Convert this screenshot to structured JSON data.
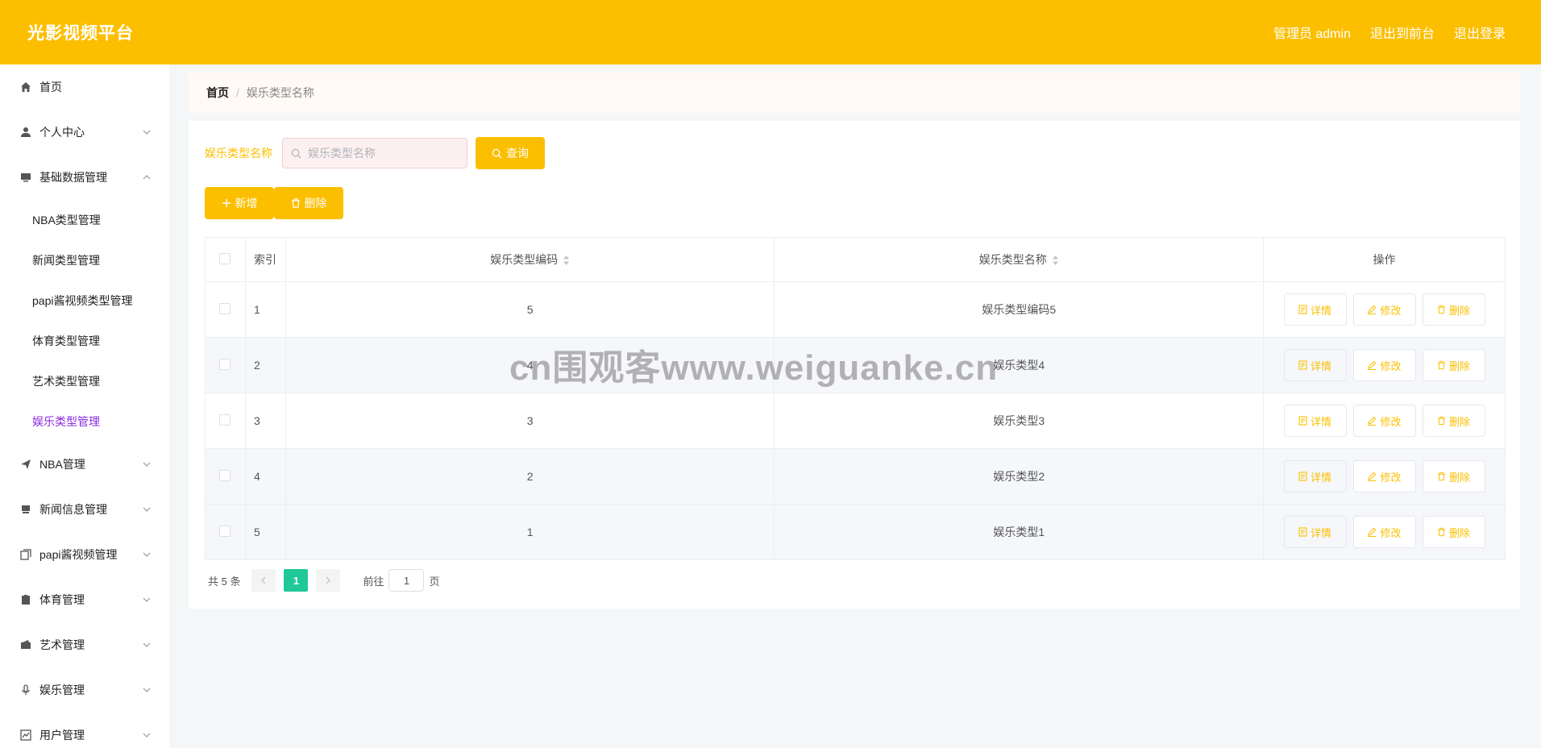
{
  "header": {
    "brand": "光影视频平台",
    "links": [
      "管理员 admin",
      "退出到前台",
      "退出登录"
    ]
  },
  "sidebar": {
    "items": [
      {
        "label": "首页",
        "icon": "home-icon"
      },
      {
        "label": "个人中心",
        "icon": "user-icon"
      },
      {
        "label": "基础数据管理",
        "icon": "monitor-icon"
      },
      {
        "label": "NBA管理",
        "icon": "send-icon"
      },
      {
        "label": "新闻信息管理",
        "icon": "printer-icon"
      },
      {
        "label": "papi酱视频管理",
        "icon": "copy-icon"
      },
      {
        "label": "体育管理",
        "icon": "clipboard-icon"
      },
      {
        "label": "艺术管理",
        "icon": "wallet-icon"
      },
      {
        "label": "娱乐管理",
        "icon": "microphone-icon"
      },
      {
        "label": "用户管理",
        "icon": "chart-icon"
      }
    ],
    "subitems": [
      "NBA类型管理",
      "新闻类型管理",
      "papi酱视频类型管理",
      "体育类型管理",
      "艺术类型管理",
      "娱乐类型管理"
    ]
  },
  "breadcrumb": {
    "home": "首页",
    "separator": "/",
    "current": "娱乐类型名称"
  },
  "search": {
    "label": "娱乐类型名称",
    "placeholder": "娱乐类型名称",
    "button": "查询"
  },
  "actions": {
    "add": "新增",
    "delete": "删除"
  },
  "table": {
    "headers": [
      "索引",
      "娱乐类型编码",
      "娱乐类型名称",
      "操作"
    ],
    "rows": [
      {
        "index": "1",
        "code": "5",
        "name": "娱乐类型编码5"
      },
      {
        "index": "2",
        "code": "4",
        "name": "娱乐类型4"
      },
      {
        "index": "3",
        "code": "3",
        "name": "娱乐类型3"
      },
      {
        "index": "4",
        "code": "2",
        "name": "娱乐类型2"
      },
      {
        "index": "5",
        "code": "1",
        "name": "娱乐类型1"
      }
    ],
    "row_buttons": {
      "detail": "详情",
      "edit": "修改",
      "delete": "删除"
    }
  },
  "pagination": {
    "total": "共 5 条",
    "current_page": "1",
    "goto_label": "前往",
    "goto_value": "1",
    "page_suffix": "页"
  },
  "watermark": "cn围观客www.weiguanke.cn",
  "colors": {
    "primary": "#fcbf00",
    "active_menu": "#8a2be2",
    "page_active": "#20c997"
  }
}
